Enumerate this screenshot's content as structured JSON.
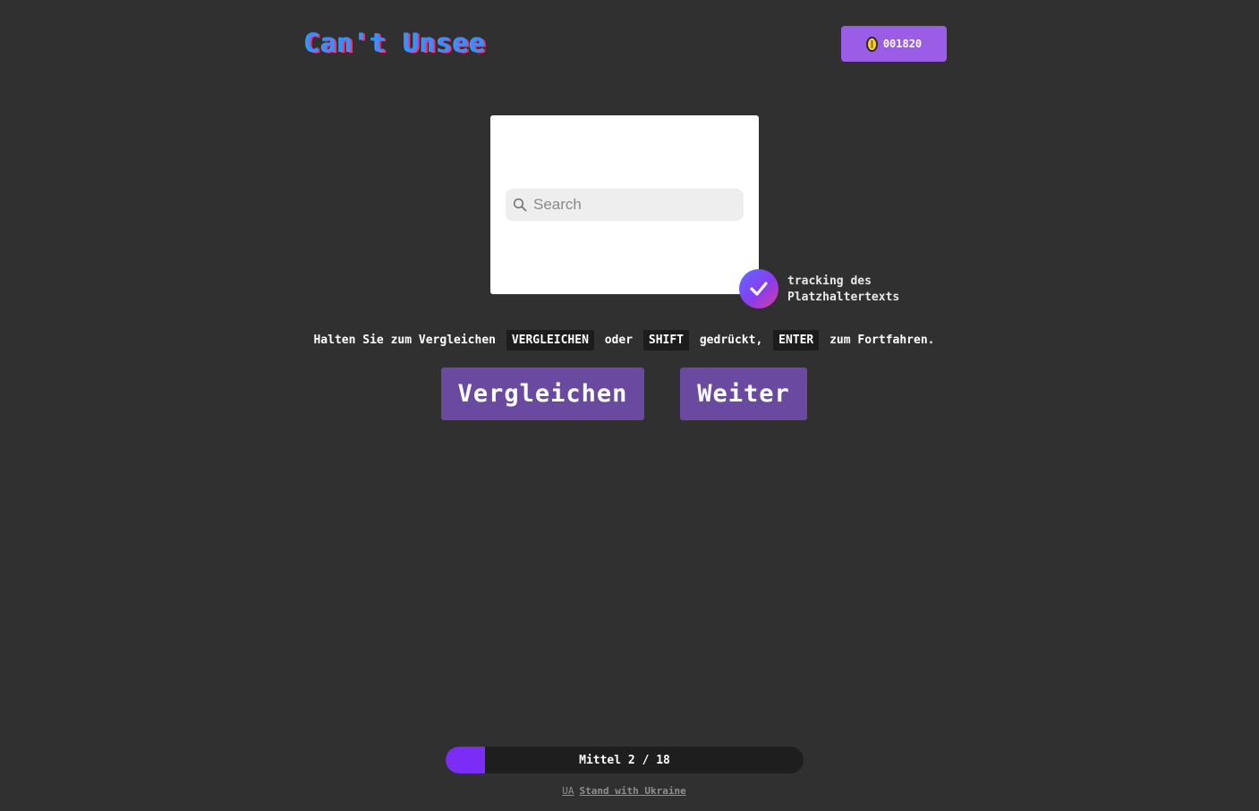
{
  "header": {
    "logo": "Can't Unsee",
    "coins": "001820",
    "coin_icon": "coin-icon"
  },
  "preview": {
    "search_placeholder": "Search",
    "search_icon": "search-icon"
  },
  "badge": {
    "icon": "check-icon",
    "text_line1": "tracking des",
    "text_line2": "Platzhaltertexts"
  },
  "instructions": {
    "part1": "Halten Sie zum Vergleichen",
    "key1": "VERGLEICHEN",
    "part2": "oder",
    "key2": "SHIFT",
    "part3": "gedrückt,",
    "key3": "ENTER",
    "part4": "zum Fortfahren."
  },
  "buttons": {
    "compare": "Vergleichen",
    "next": "Weiter"
  },
  "progress": {
    "label": "Mittel 2 / 18",
    "current": 2,
    "total": 18,
    "fill_color": "#7b2cf5"
  },
  "footer": {
    "flag": "UA",
    "link": "Stand with Ukraine"
  },
  "colors": {
    "background": "#303030",
    "accent": "#9b5de5",
    "button": "#6a4aa0"
  }
}
